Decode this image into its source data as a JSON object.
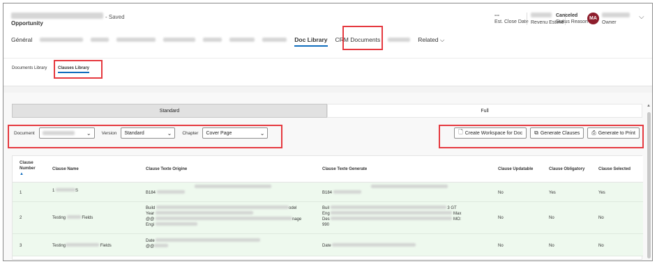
{
  "header": {
    "saved": "- Saved",
    "entity": "Opportunity",
    "close_date_value": "---",
    "close_date_label": "Est. Close Date",
    "revenue_label": "Revenu Estimé",
    "status_value": "Canceled",
    "status_label": "Status Reason",
    "avatar_initials": "MA",
    "owner_label": "Owner"
  },
  "tabs": {
    "general": "Général",
    "doc_library": "Doc Library",
    "crm_documents": "CRM Documents",
    "related": "Related"
  },
  "subtabs": {
    "documents_library": "Documents Library",
    "clauses_library": "Clauses Library"
  },
  "segments": {
    "standard": "Standard",
    "full": "Full"
  },
  "filters": {
    "document_label": "Document",
    "version_label": "Version",
    "version_value": "Standard",
    "chapter_label": "Chapter",
    "chapter_value": "Cover Page"
  },
  "actions": {
    "create_workspace": "Create Workspace for Doc",
    "generate_clauses": "Generate Clauses",
    "generate_print": "Generate to Print"
  },
  "table": {
    "headers": {
      "number": "Clause Number",
      "name": "Clause Name",
      "origine": "Clause Texte Origine",
      "generate": "Clause Texte Generate",
      "updatable": "Clause Updatable",
      "obligatory": "Clause Obligatory",
      "selected": "Clause Selected"
    },
    "rows": [
      {
        "number": "1",
        "name_a": "1",
        "name_b": "S",
        "origine": "B184",
        "generate": "B184",
        "updatable": "No",
        "obligatory": "Yes",
        "selected": "Yes"
      },
      {
        "number": "2",
        "name_a": "Testing",
        "name_b": "Fields",
        "origine_l1": "Build",
        "origine_l1_end": "odel",
        "origine_l2": "Year",
        "origine_l3": "@@",
        "origine_l3_end": "nage",
        "origine_l4": "Engi",
        "generate_l1": "Buil",
        "generate_l1_end": "3 GT",
        "generate_l2": "Eng",
        "generate_l2_end": "Max",
        "generate_l3": "Des",
        "generate_l3_end": "MO:",
        "generate_l4": "990",
        "updatable": "No",
        "obligatory": "No",
        "selected": "No"
      },
      {
        "number": "3",
        "name_a": "Testing",
        "name_b": "Fields",
        "origine_l1": "Date",
        "origine_l2": "@@",
        "generate": "Date",
        "updatable": "No",
        "obligatory": "No",
        "selected": "No"
      }
    ]
  },
  "colors": {
    "accent": "#0f6cbd",
    "highlight": "#e5393f",
    "avatar": "#8d1d2c",
    "row_bg": "#eef9ee"
  }
}
